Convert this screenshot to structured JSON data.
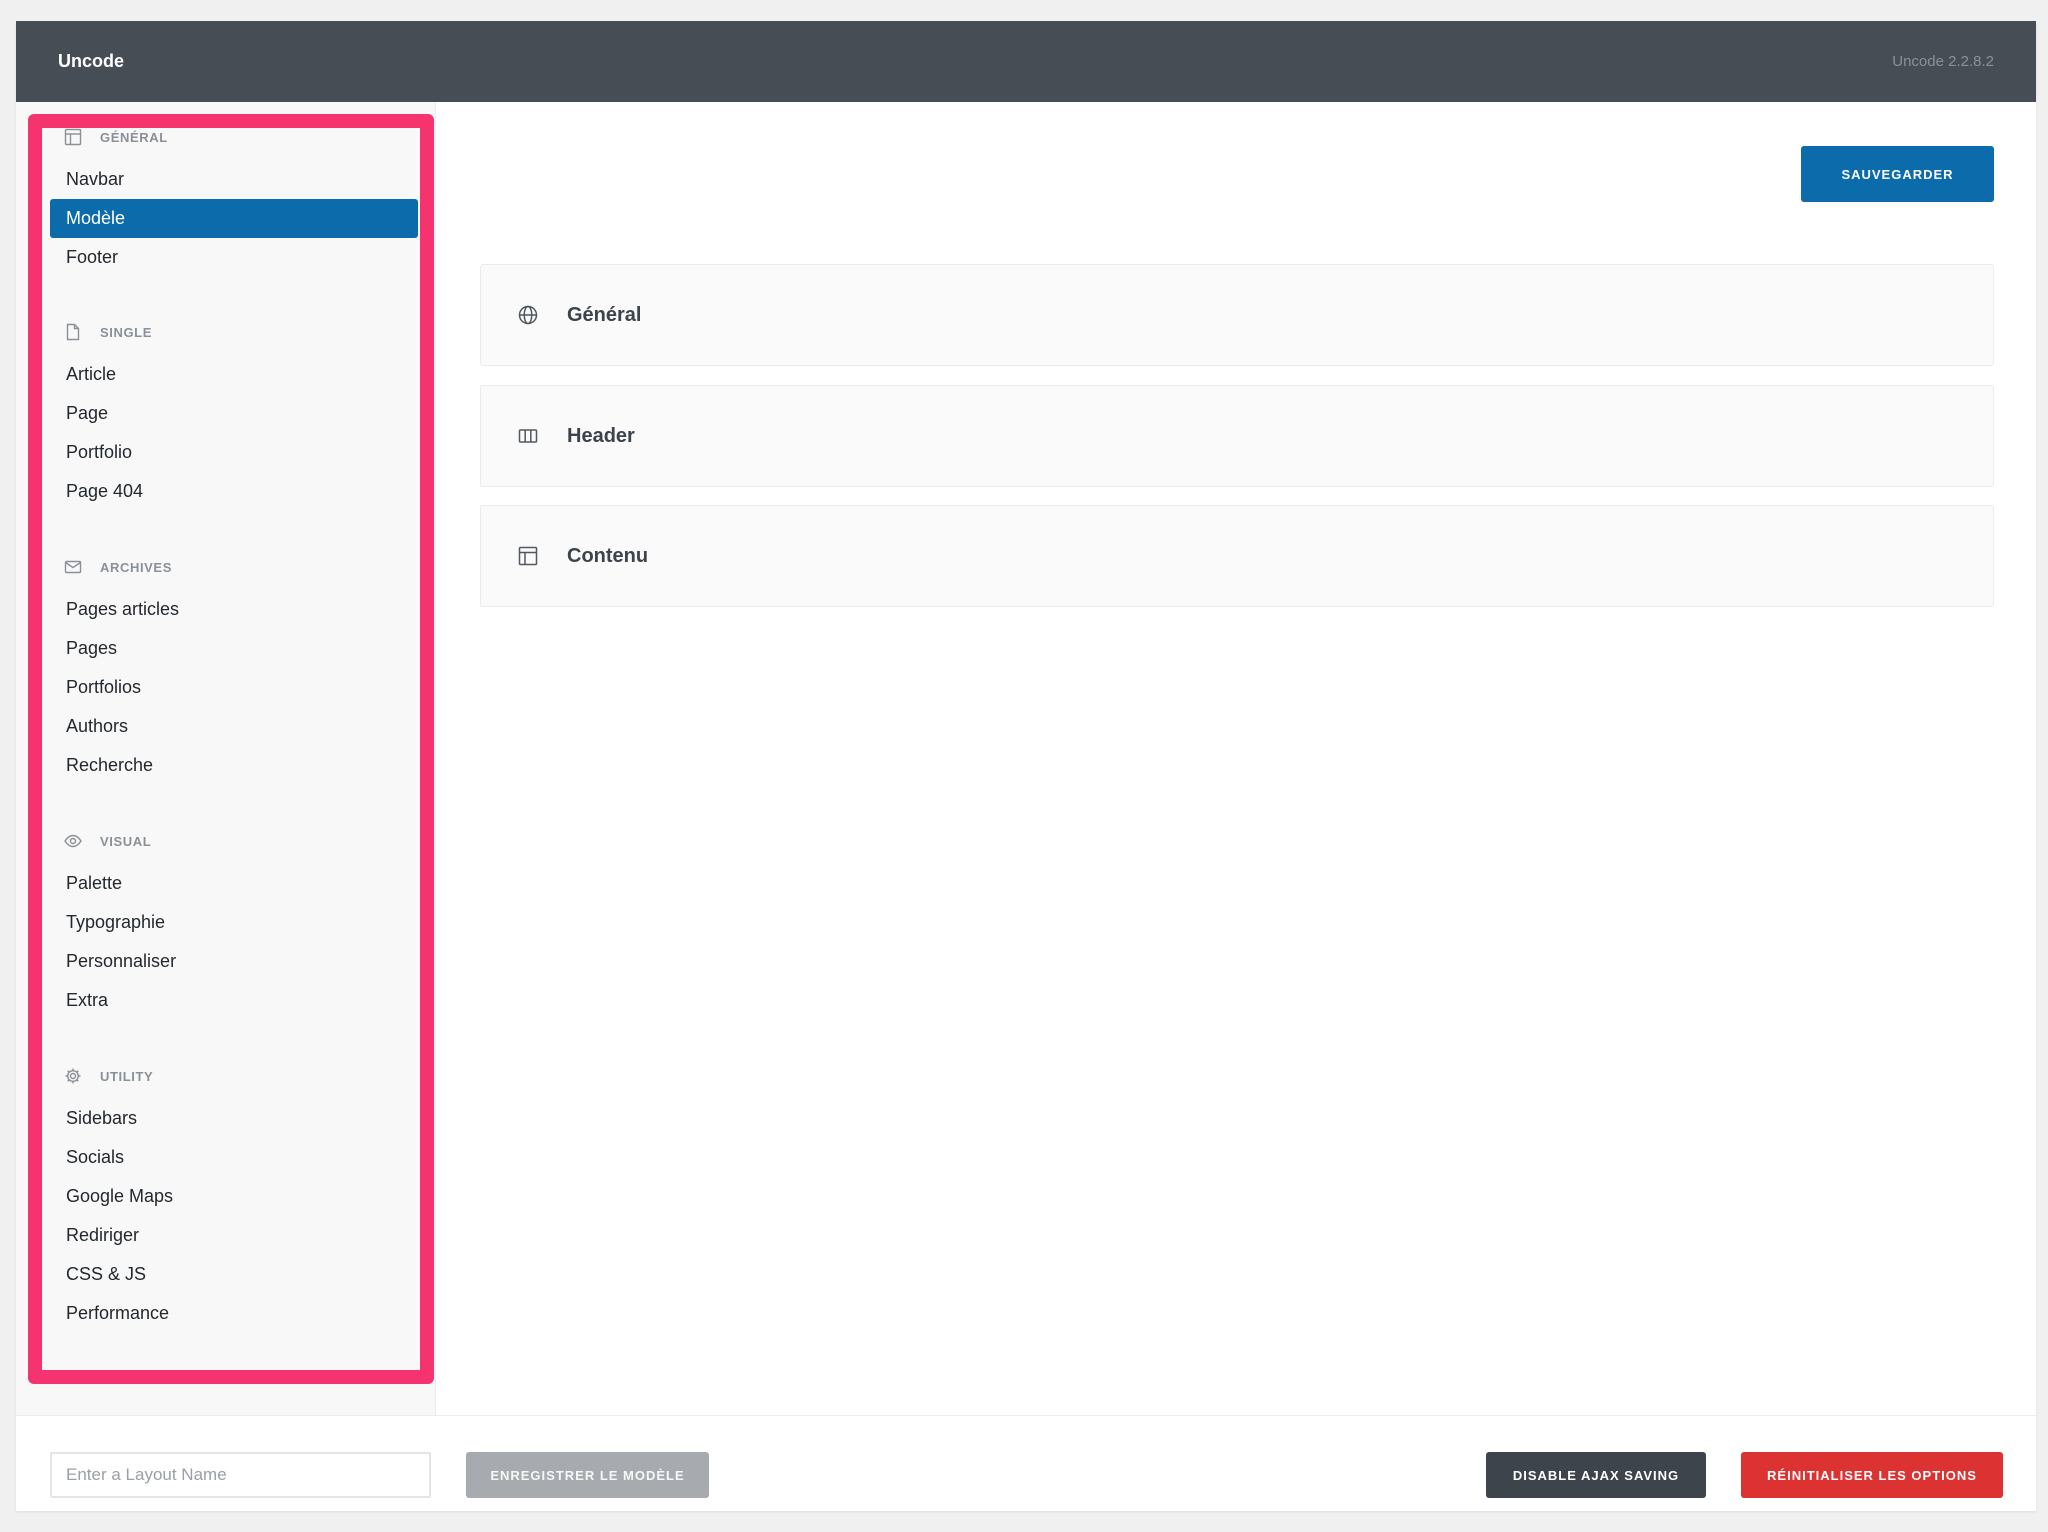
{
  "app": {
    "brand": "Uncode",
    "version": "Uncode 2.2.8.2"
  },
  "sidebar": {
    "sections": [
      {
        "heading": "GÉNÉRAL",
        "icon": "layout-icon",
        "items": [
          {
            "label": "Navbar",
            "active": false
          },
          {
            "label": "Modèle",
            "active": true
          },
          {
            "label": "Footer",
            "active": false
          }
        ]
      },
      {
        "heading": "SINGLE",
        "icon": "file-icon",
        "items": [
          {
            "label": "Article"
          },
          {
            "label": "Page"
          },
          {
            "label": "Portfolio"
          },
          {
            "label": "Page 404"
          }
        ]
      },
      {
        "heading": "ARCHIVES",
        "icon": "envelope-icon",
        "items": [
          {
            "label": "Pages articles"
          },
          {
            "label": "Pages"
          },
          {
            "label": "Portfolios"
          },
          {
            "label": "Authors"
          },
          {
            "label": "Recherche"
          }
        ]
      },
      {
        "heading": "VISUAL",
        "icon": "eye-icon",
        "items": [
          {
            "label": "Palette"
          },
          {
            "label": "Typographie"
          },
          {
            "label": "Personnaliser"
          },
          {
            "label": "Extra"
          }
        ]
      },
      {
        "heading": "UTILITY",
        "icon": "gear-icon",
        "items": [
          {
            "label": "Sidebars"
          },
          {
            "label": "Socials"
          },
          {
            "label": "Google Maps"
          },
          {
            "label": "Rediriger"
          },
          {
            "label": "CSS & JS"
          },
          {
            "label": "Performance"
          }
        ]
      }
    ]
  },
  "main": {
    "save_label": "SAUVEGARDER",
    "panels": [
      {
        "label": "Général",
        "icon": "globe-icon"
      },
      {
        "label": "Header",
        "icon": "columns-icon"
      },
      {
        "label": "Contenu",
        "icon": "layout-icon"
      }
    ]
  },
  "footer": {
    "layout_name_placeholder": "Enter a Layout Name",
    "save_layout_label": "ENREGISTRER LE MODÈLE",
    "disable_ajax_label": "DISABLE AJAX SAVING",
    "reset_label": "RÉINITIALISER LES OPTIONS"
  },
  "colors": {
    "topbar": "#464d55",
    "accent": "#0c6bab",
    "highlight": "#f5346f",
    "danger": "#dc3232",
    "dark_button": "#3d444b"
  }
}
